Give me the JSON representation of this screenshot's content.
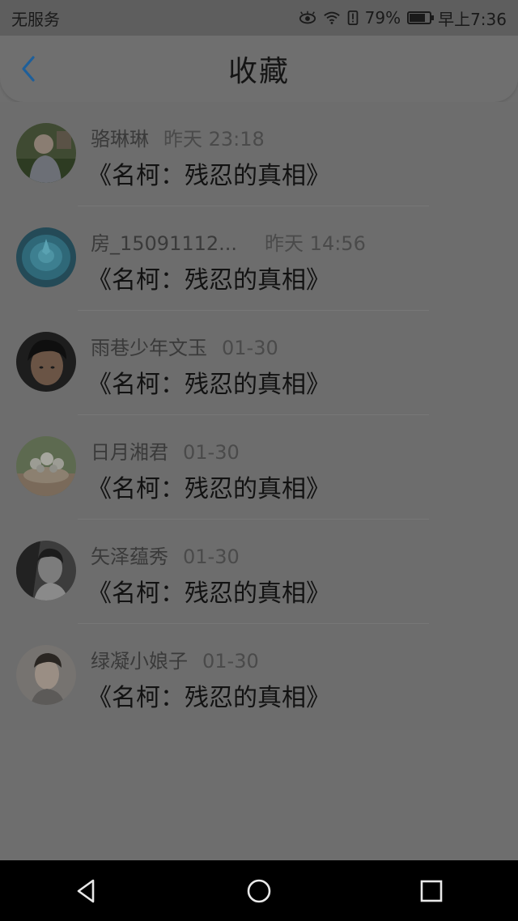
{
  "status_bar": {
    "carrier": "无服务",
    "battery_percent": "79%",
    "battery_level": 0.79,
    "time": "早上7:36",
    "icons": [
      "eye-comfort-icon",
      "wifi-icon",
      "alert-icon",
      "battery-icon"
    ]
  },
  "header": {
    "back_icon": "chevron-left-icon",
    "title": "收藏"
  },
  "items": [
    {
      "name": "骆琳琳",
      "time": "昨天 23:18",
      "title": "《名柯：残忍的真相》",
      "avatar": "avatar-boy-outdoor"
    },
    {
      "name": "房_15091112...",
      "time": "昨天 14:56",
      "title": "《名柯：残忍的真相》",
      "avatar": "avatar-succulent"
    },
    {
      "name": "雨巷少年文玉",
      "time": "01-30",
      "title": "《名柯：残忍的真相》",
      "avatar": "avatar-young-man"
    },
    {
      "name": "日月湘君",
      "time": "01-30",
      "title": "《名柯：残忍的真相》",
      "avatar": "avatar-flowers"
    },
    {
      "name": "矢泽蕴秀",
      "time": "01-30",
      "title": "《名柯：残忍的真相》",
      "avatar": "avatar-bw-portrait"
    },
    {
      "name": "绿凝小娘子",
      "time": "01-30",
      "title": "《名柯：残忍的真相》",
      "avatar": "avatar-man-light"
    }
  ],
  "nav_bar": {
    "back_icon": "triangle-back-icon",
    "home_icon": "circle-home-icon",
    "recent_icon": "square-recents-icon"
  },
  "colors": {
    "accent": "#1e5f9a",
    "overlay_background": "#6d6d6d",
    "nav_bar": "#000000"
  }
}
